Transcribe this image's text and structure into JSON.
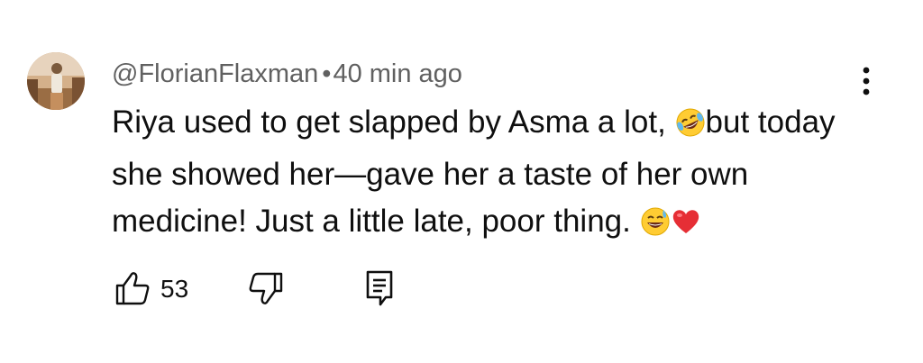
{
  "comment": {
    "author": "@FlorianFlaxman",
    "separator": "•",
    "timestamp": "40 min ago",
    "text_line_1_a": "Riya used to get slapped by Asma a lot, ",
    "emoji_1": "rolling-on-floor-laughing",
    "text_line_1_b": "but today",
    "text_line_2": "she showed her—gave her a taste of her own",
    "text_line_3": "medicine! Just a little late, poor thing. ",
    "emoji_2": "grinning-sweat",
    "emoji_3": "red-heart"
  },
  "actions": {
    "like_icon": "thumbs-up-icon",
    "like_count": "53",
    "dislike_icon": "thumbs-down-icon",
    "reply_icon": "reply-comment-icon",
    "more_icon": "three-dots-vertical-icon"
  },
  "colors": {
    "text": "#0f0f0f",
    "meta": "#606060",
    "background": "#ffffff"
  }
}
